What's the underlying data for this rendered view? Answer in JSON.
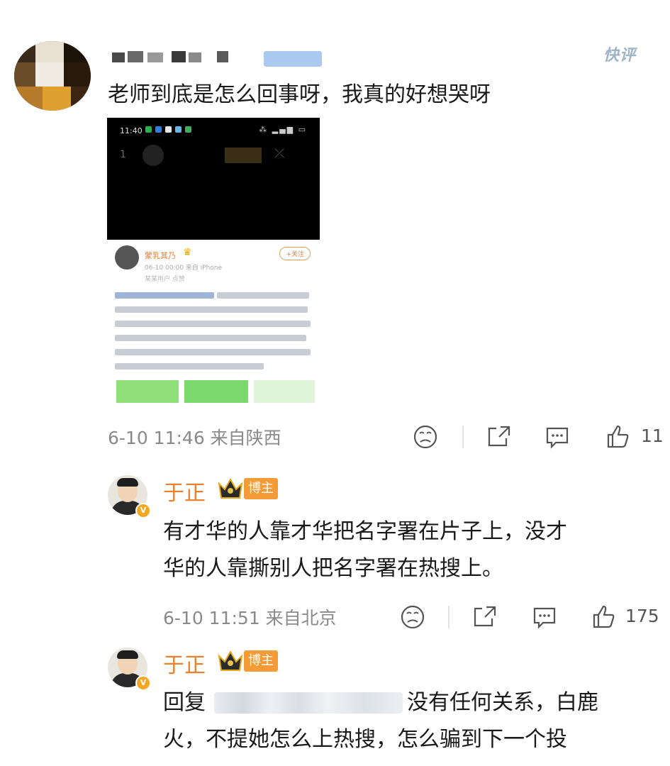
{
  "brand": "快评",
  "comment": {
    "text": "老师到底是怎么回事呀，我真的好想哭呀",
    "timestamp": "6-10 11:46 来自陕西",
    "likes": "11"
  },
  "embedded_shot": {
    "status_time": "11:40",
    "author_name": "蒙乳其乃",
    "follow_label": "+关注",
    "meta": "06-10 00:00 来自 iPhone",
    "meta2": "某某用户 点赞"
  },
  "replies": [
    {
      "name": "于正",
      "badge": "博主",
      "text_lines": [
        "有才华的人靠才华把名字署在片子上，没才",
        "华的人靠撕别人把名字署在热搜上。"
      ],
      "timestamp": "6-10 11:51 来自北京",
      "likes": "175"
    },
    {
      "name": "于正",
      "badge": "博主",
      "reply_prefix": "回复",
      "text_after": "没有任何关系，白鹿",
      "text_line2": "火，不提她怎么上热搜，怎么骗到下一个投"
    }
  ],
  "colors": {
    "accent_orange": "#e8822e",
    "badge_orange": "#f39b37",
    "meta_gray": "#8a8a8a"
  }
}
